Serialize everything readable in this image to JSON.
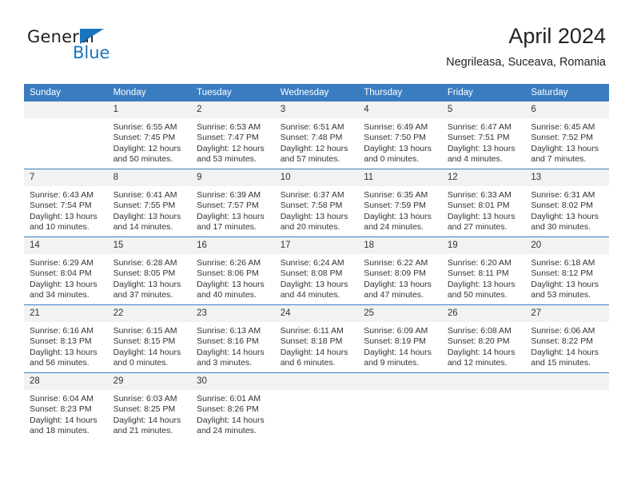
{
  "brand": {
    "name_dark": "General",
    "name_blue": "Blue",
    "accent_color": "#1b75bb"
  },
  "header": {
    "month_title": "April 2024",
    "location": "Negrileasa, Suceava, Romania",
    "header_bg": "#3a7cc0",
    "daynum_bg": "#f2f2f2"
  },
  "weekday_headers": [
    "Sunday",
    "Monday",
    "Tuesday",
    "Wednesday",
    "Thursday",
    "Friday",
    "Saturday"
  ],
  "labels": {
    "sunrise_prefix": "Sunrise: ",
    "sunset_prefix": "Sunset: ",
    "daylight_prefix": "Daylight: "
  },
  "weeks": [
    [
      {
        "day": "",
        "blank": true
      },
      {
        "day": "1",
        "sunrise": "Sunrise: 6:55 AM",
        "sunset": "Sunset: 7:45 PM",
        "daylight1": "Daylight: 12 hours",
        "daylight2": "and 50 minutes."
      },
      {
        "day": "2",
        "sunrise": "Sunrise: 6:53 AM",
        "sunset": "Sunset: 7:47 PM",
        "daylight1": "Daylight: 12 hours",
        "daylight2": "and 53 minutes."
      },
      {
        "day": "3",
        "sunrise": "Sunrise: 6:51 AM",
        "sunset": "Sunset: 7:48 PM",
        "daylight1": "Daylight: 12 hours",
        "daylight2": "and 57 minutes."
      },
      {
        "day": "4",
        "sunrise": "Sunrise: 6:49 AM",
        "sunset": "Sunset: 7:50 PM",
        "daylight1": "Daylight: 13 hours",
        "daylight2": "and 0 minutes."
      },
      {
        "day": "5",
        "sunrise": "Sunrise: 6:47 AM",
        "sunset": "Sunset: 7:51 PM",
        "daylight1": "Daylight: 13 hours",
        "daylight2": "and 4 minutes."
      },
      {
        "day": "6",
        "sunrise": "Sunrise: 6:45 AM",
        "sunset": "Sunset: 7:52 PM",
        "daylight1": "Daylight: 13 hours",
        "daylight2": "and 7 minutes."
      }
    ],
    [
      {
        "day": "7",
        "sunrise": "Sunrise: 6:43 AM",
        "sunset": "Sunset: 7:54 PM",
        "daylight1": "Daylight: 13 hours",
        "daylight2": "and 10 minutes."
      },
      {
        "day": "8",
        "sunrise": "Sunrise: 6:41 AM",
        "sunset": "Sunset: 7:55 PM",
        "daylight1": "Daylight: 13 hours",
        "daylight2": "and 14 minutes."
      },
      {
        "day": "9",
        "sunrise": "Sunrise: 6:39 AM",
        "sunset": "Sunset: 7:57 PM",
        "daylight1": "Daylight: 13 hours",
        "daylight2": "and 17 minutes."
      },
      {
        "day": "10",
        "sunrise": "Sunrise: 6:37 AM",
        "sunset": "Sunset: 7:58 PM",
        "daylight1": "Daylight: 13 hours",
        "daylight2": "and 20 minutes."
      },
      {
        "day": "11",
        "sunrise": "Sunrise: 6:35 AM",
        "sunset": "Sunset: 7:59 PM",
        "daylight1": "Daylight: 13 hours",
        "daylight2": "and 24 minutes."
      },
      {
        "day": "12",
        "sunrise": "Sunrise: 6:33 AM",
        "sunset": "Sunset: 8:01 PM",
        "daylight1": "Daylight: 13 hours",
        "daylight2": "and 27 minutes."
      },
      {
        "day": "13",
        "sunrise": "Sunrise: 6:31 AM",
        "sunset": "Sunset: 8:02 PM",
        "daylight1": "Daylight: 13 hours",
        "daylight2": "and 30 minutes."
      }
    ],
    [
      {
        "day": "14",
        "sunrise": "Sunrise: 6:29 AM",
        "sunset": "Sunset: 8:04 PM",
        "daylight1": "Daylight: 13 hours",
        "daylight2": "and 34 minutes."
      },
      {
        "day": "15",
        "sunrise": "Sunrise: 6:28 AM",
        "sunset": "Sunset: 8:05 PM",
        "daylight1": "Daylight: 13 hours",
        "daylight2": "and 37 minutes."
      },
      {
        "day": "16",
        "sunrise": "Sunrise: 6:26 AM",
        "sunset": "Sunset: 8:06 PM",
        "daylight1": "Daylight: 13 hours",
        "daylight2": "and 40 minutes."
      },
      {
        "day": "17",
        "sunrise": "Sunrise: 6:24 AM",
        "sunset": "Sunset: 8:08 PM",
        "daylight1": "Daylight: 13 hours",
        "daylight2": "and 44 minutes."
      },
      {
        "day": "18",
        "sunrise": "Sunrise: 6:22 AM",
        "sunset": "Sunset: 8:09 PM",
        "daylight1": "Daylight: 13 hours",
        "daylight2": "and 47 minutes."
      },
      {
        "day": "19",
        "sunrise": "Sunrise: 6:20 AM",
        "sunset": "Sunset: 8:11 PM",
        "daylight1": "Daylight: 13 hours",
        "daylight2": "and 50 minutes."
      },
      {
        "day": "20",
        "sunrise": "Sunrise: 6:18 AM",
        "sunset": "Sunset: 8:12 PM",
        "daylight1": "Daylight: 13 hours",
        "daylight2": "and 53 minutes."
      }
    ],
    [
      {
        "day": "21",
        "sunrise": "Sunrise: 6:16 AM",
        "sunset": "Sunset: 8:13 PM",
        "daylight1": "Daylight: 13 hours",
        "daylight2": "and 56 minutes."
      },
      {
        "day": "22",
        "sunrise": "Sunrise: 6:15 AM",
        "sunset": "Sunset: 8:15 PM",
        "daylight1": "Daylight: 14 hours",
        "daylight2": "and 0 minutes."
      },
      {
        "day": "23",
        "sunrise": "Sunrise: 6:13 AM",
        "sunset": "Sunset: 8:16 PM",
        "daylight1": "Daylight: 14 hours",
        "daylight2": "and 3 minutes."
      },
      {
        "day": "24",
        "sunrise": "Sunrise: 6:11 AM",
        "sunset": "Sunset: 8:18 PM",
        "daylight1": "Daylight: 14 hours",
        "daylight2": "and 6 minutes."
      },
      {
        "day": "25",
        "sunrise": "Sunrise: 6:09 AM",
        "sunset": "Sunset: 8:19 PM",
        "daylight1": "Daylight: 14 hours",
        "daylight2": "and 9 minutes."
      },
      {
        "day": "26",
        "sunrise": "Sunrise: 6:08 AM",
        "sunset": "Sunset: 8:20 PM",
        "daylight1": "Daylight: 14 hours",
        "daylight2": "and 12 minutes."
      },
      {
        "day": "27",
        "sunrise": "Sunrise: 6:06 AM",
        "sunset": "Sunset: 8:22 PM",
        "daylight1": "Daylight: 14 hours",
        "daylight2": "and 15 minutes."
      }
    ],
    [
      {
        "day": "28",
        "sunrise": "Sunrise: 6:04 AM",
        "sunset": "Sunset: 8:23 PM",
        "daylight1": "Daylight: 14 hours",
        "daylight2": "and 18 minutes."
      },
      {
        "day": "29",
        "sunrise": "Sunrise: 6:03 AM",
        "sunset": "Sunset: 8:25 PM",
        "daylight1": "Daylight: 14 hours",
        "daylight2": "and 21 minutes."
      },
      {
        "day": "30",
        "sunrise": "Sunrise: 6:01 AM",
        "sunset": "Sunset: 8:26 PM",
        "daylight1": "Daylight: 14 hours",
        "daylight2": "and 24 minutes."
      },
      {
        "day": "",
        "blank": true
      },
      {
        "day": "",
        "blank": true
      },
      {
        "day": "",
        "blank": true
      },
      {
        "day": "",
        "blank": true
      }
    ]
  ]
}
